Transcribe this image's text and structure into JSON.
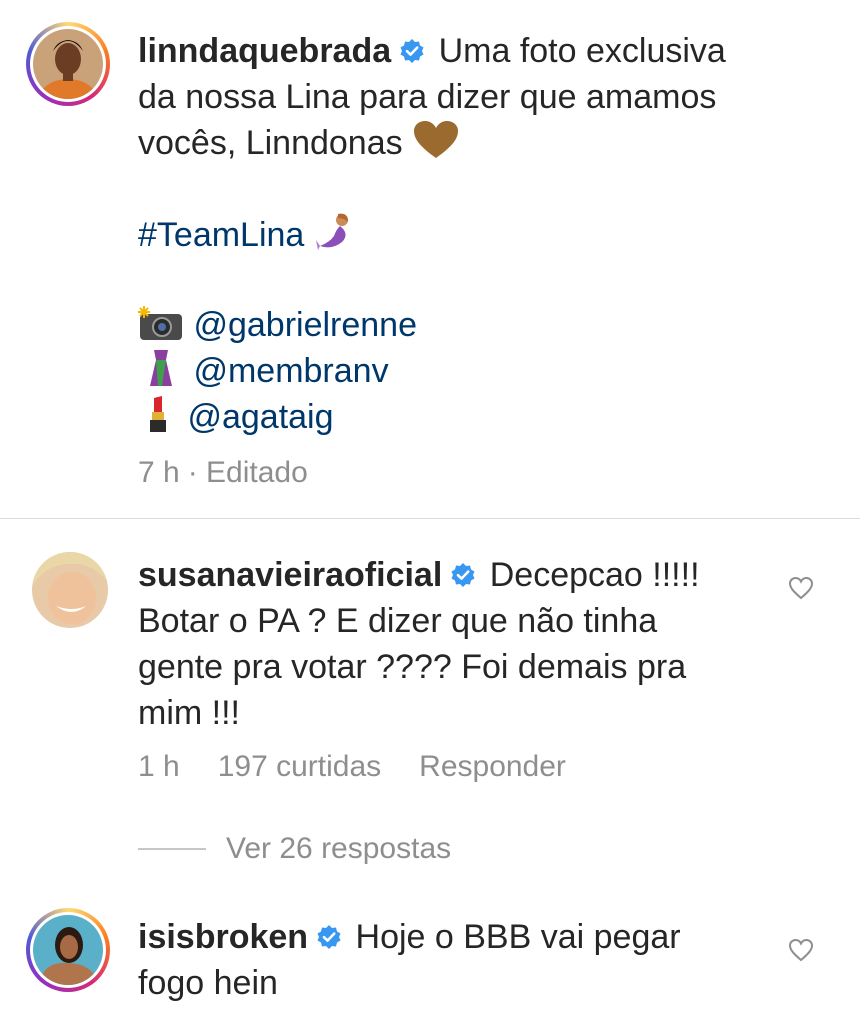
{
  "post": {
    "username": "linndaquebrada",
    "caption_lines": [
      "Uma foto exclusiva",
      "da nossa Lina para dizer que amamos",
      "vocês, Linndonas"
    ],
    "hashtag": "#TeamLina",
    "credits": [
      "@gabrielrenne",
      "@membranv",
      "@agataig"
    ],
    "time": "7 h",
    "edited": "· Editado"
  },
  "comments": [
    {
      "username": "susanavieiraoficial",
      "lines": [
        "Decepcao !!!!!",
        "Botar o PA ? E dizer que não tinha",
        "gente pra votar ???? Foi demais pra",
        "mim !!!"
      ],
      "time": "1 h",
      "likes": "197 curtidas",
      "reply": "Responder",
      "view_replies": "Ver 26 respostas"
    },
    {
      "username": "isisbroken",
      "lines": [
        "Hoje o BBB vai pegar",
        "fogo hein"
      ]
    }
  ],
  "icons": {
    "verified": "verified-badge-icon",
    "heart": "heart-outline-icon",
    "brown_heart": "brown-heart-emoji",
    "mermaid": "mermaid-emoji",
    "camera": "camera-flash-emoji",
    "dress": "sari-emoji",
    "lipstick": "lipstick-emoji"
  },
  "colors": {
    "link": "#00376b",
    "verified": "#3897f0",
    "muted": "#8e8e8e"
  }
}
